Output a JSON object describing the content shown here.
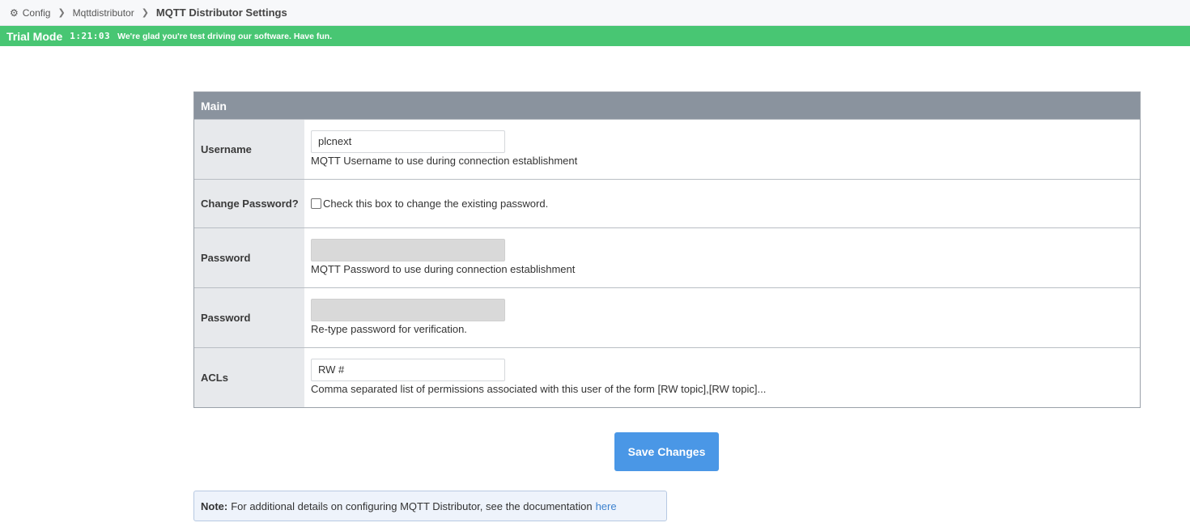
{
  "breadcrumb": {
    "icon": "gear-icon",
    "items": [
      "Config",
      "Mqttdistributor"
    ],
    "current": "MQTT Distributor Settings"
  },
  "trial": {
    "label": "Trial Mode",
    "time": "1:21:03",
    "message": "We're glad you're test driving our software. Have fun.",
    "color": "#48c673"
  },
  "panel": {
    "title": "Main",
    "rows": {
      "username": {
        "label": "Username",
        "value": "plcnext",
        "help": "MQTT Username to use during connection establishment"
      },
      "change_password": {
        "label": "Change Password?",
        "checked": false,
        "text": "Check this box to change the existing password."
      },
      "password": {
        "label": "Password",
        "value": "",
        "help": "MQTT Password to use during connection establishment"
      },
      "password_confirm": {
        "label": "Password",
        "value": "",
        "help": "Re-type password for verification."
      },
      "acls": {
        "label": "ACLs",
        "value": "RW #",
        "help": "Comma separated list of permissions associated with this user of the form [RW topic],[RW topic]..."
      }
    }
  },
  "save_button": {
    "label": "Save Changes",
    "color": "#4a97e6"
  },
  "note": {
    "label": "Note:",
    "text": "For additional details on configuring MQTT Distributor, see the documentation",
    "link": "here"
  }
}
